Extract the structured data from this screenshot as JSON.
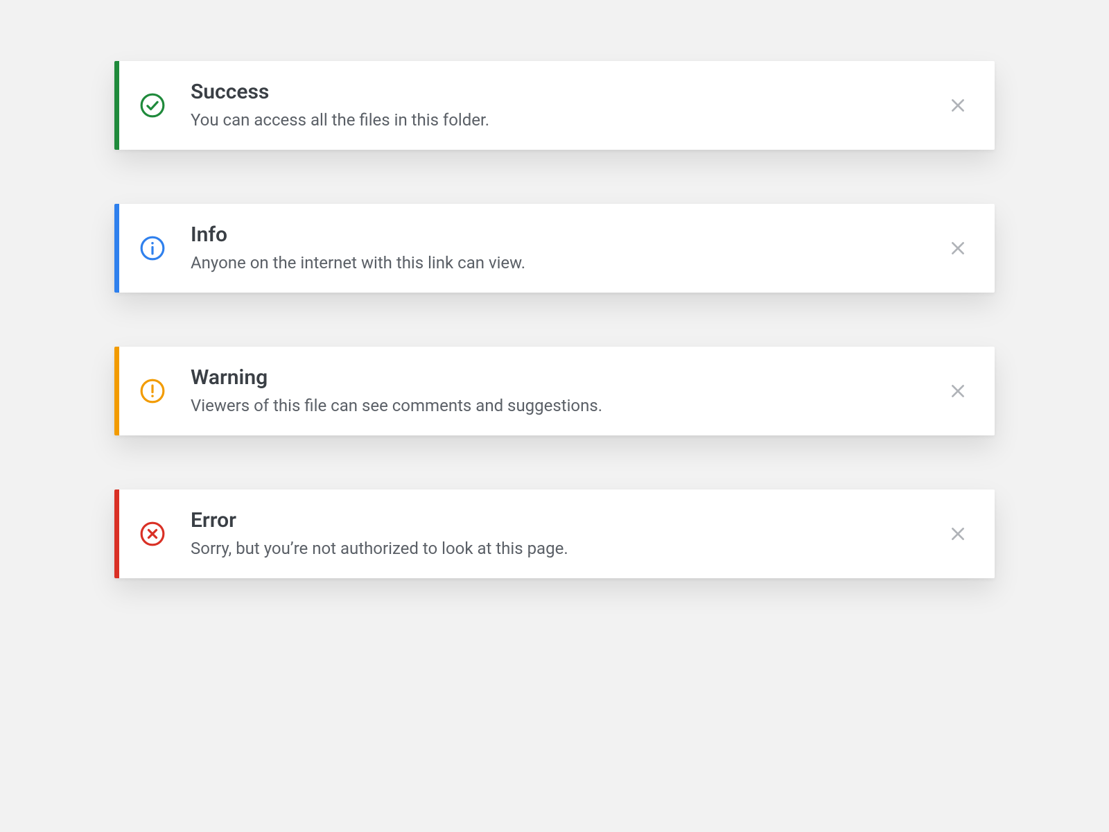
{
  "colors": {
    "success": "#1f8a3b",
    "info": "#2f80ed",
    "warning": "#f29b00",
    "error": "#d93025",
    "close": "#b0b3b8"
  },
  "alerts": [
    {
      "kind": "success",
      "icon": "check-circle-icon",
      "title": "Success",
      "message": "You can access all the files in this folder."
    },
    {
      "kind": "info",
      "icon": "info-circle-icon",
      "title": "Info",
      "message": "Anyone on the internet with this link can view."
    },
    {
      "kind": "warning",
      "icon": "alert-circle-icon",
      "title": "Warning",
      "message": "Viewers of this file can see comments and suggestions."
    },
    {
      "kind": "error",
      "icon": "x-circle-icon",
      "title": "Error",
      "message": "Sorry, but you’re not authorized to look at this page."
    }
  ]
}
